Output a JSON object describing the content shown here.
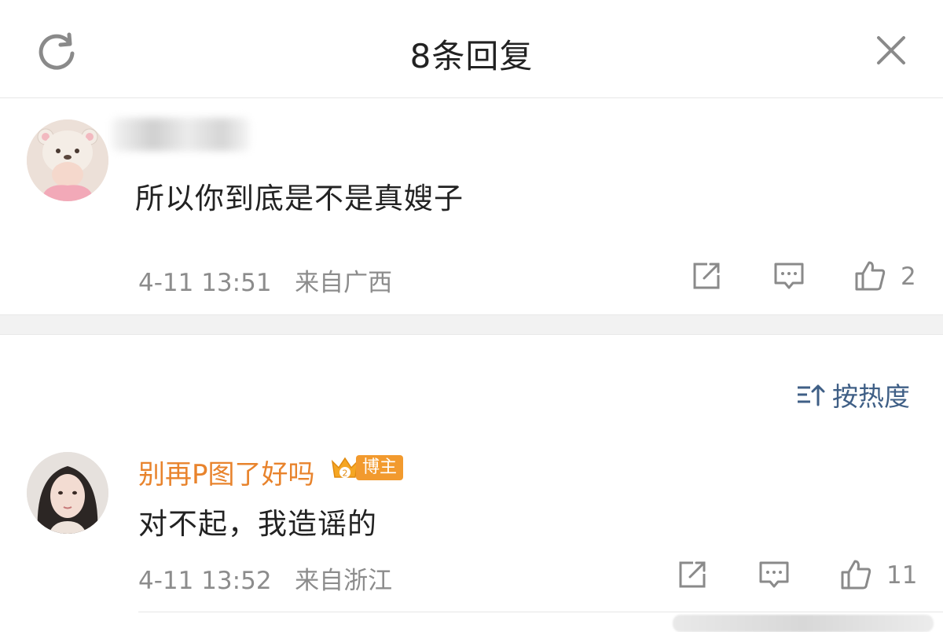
{
  "header": {
    "title": "8条回复",
    "refresh_icon": "refresh-icon",
    "close_icon": "close-icon"
  },
  "root_comment": {
    "text": "所以你到底是不是真嫂子",
    "time": "4-11 13:51",
    "location": "来自广西",
    "likes": "2"
  },
  "sort": {
    "label": "按热度",
    "icon": "sort-icon"
  },
  "replies": [
    {
      "username": "别再P图了好吗",
      "badge_label": "博主",
      "badge_number": "2",
      "text": "对不起，我造谣的",
      "time": "4-11 13:52",
      "location": "来自浙江",
      "likes": "11"
    }
  ],
  "colors": {
    "username": "#e8832c",
    "sort_link": "#3f5f86",
    "meta": "#8c8c8c",
    "badge": "#f29a2e"
  }
}
